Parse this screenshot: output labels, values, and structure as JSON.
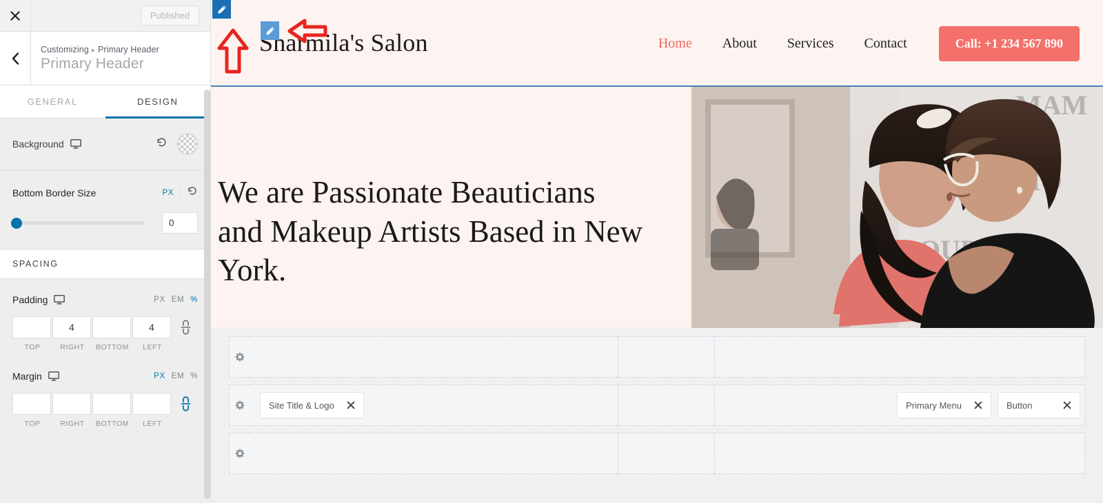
{
  "customizer": {
    "close_icon": "close-icon",
    "publish_label": "Published",
    "back_icon": "chevron-left-icon",
    "breadcrumb_root": "Customizing",
    "breadcrumb_sep": "▸",
    "breadcrumb_current": "Primary Header",
    "panel_title": "Primary Header",
    "tabs": [
      {
        "label": "GENERAL",
        "active": false
      },
      {
        "label": "DESIGN",
        "active": true
      }
    ],
    "background": {
      "label": "Background",
      "responsive_icon": "desktop-icon",
      "reset_icon": "reset-icon",
      "swatch_icon": "transparent-color-swatch"
    },
    "bottom_border": {
      "label": "Bottom Border Size",
      "unit": "PX",
      "reset_icon": "reset-icon",
      "value": "0",
      "slider_percent": 0
    },
    "spacing_section_title": "SPACING",
    "padding": {
      "label": "Padding",
      "responsive_icon": "desktop-icon",
      "units": [
        {
          "label": "PX",
          "active": false
        },
        {
          "label": "EM",
          "active": false
        },
        {
          "label": "%",
          "active": true
        }
      ],
      "fields": [
        {
          "caption": "TOP",
          "value": ""
        },
        {
          "caption": "RIGHT",
          "value": "4"
        },
        {
          "caption": "BOTTOM",
          "value": ""
        },
        {
          "caption": "LEFT",
          "value": "4"
        }
      ],
      "link_icon": "link-unlinked-icon",
      "link_active": false
    },
    "margin": {
      "label": "Margin",
      "responsive_icon": "desktop-icon",
      "units": [
        {
          "label": "PX",
          "active": true
        },
        {
          "label": "EM",
          "active": false
        },
        {
          "label": "%",
          "active": false
        }
      ],
      "fields": [
        {
          "caption": "TOP",
          "value": ""
        },
        {
          "caption": "RIGHT",
          "value": ""
        },
        {
          "caption": "BOTTOM",
          "value": ""
        },
        {
          "caption": "LEFT",
          "value": ""
        }
      ],
      "link_icon": "link-linked-icon",
      "link_active": true
    },
    "scrollbar": "sidebar-scrollbar"
  },
  "preview": {
    "site_title": "Sharmila's Salon",
    "nav": [
      {
        "label": "Home",
        "active": true
      },
      {
        "label": "About",
        "active": false
      },
      {
        "label": "Services",
        "active": false
      },
      {
        "label": "Contact",
        "active": false
      }
    ],
    "cta_label": "Call: +1 234 567 890",
    "hero_heading": "We are Passionate Beauticians and Makeup Artists Based in New York.",
    "hero_image_alt": "two-women-in-salon-photo",
    "edit_icons": [
      {
        "name": "edit-pencil-header-icon"
      },
      {
        "name": "edit-pencil-site-title-icon"
      }
    ],
    "annotations": [
      {
        "name": "red-arrow-up",
        "direction": "up"
      },
      {
        "name": "red-arrow-left",
        "direction": "left"
      }
    ]
  },
  "builder": {
    "rows": [
      {
        "name": "above-header-row",
        "gear_icon": "gear-icon",
        "left_items": [],
        "right_items": []
      },
      {
        "name": "primary-header-row",
        "gear_icon": "gear-icon",
        "left_items": [
          {
            "label": "Site Title & Logo",
            "remove_icon": "close-icon"
          }
        ],
        "right_items": [
          {
            "label": "Primary Menu",
            "remove_icon": "close-icon"
          },
          {
            "label": "Button",
            "remove_icon": "close-icon"
          }
        ]
      },
      {
        "name": "below-header-row",
        "gear_icon": "gear-icon",
        "left_items": [],
        "right_items": []
      }
    ]
  },
  "colors": {
    "accent_blue": "#0073aa",
    "brand_salmon": "#f4706a",
    "site_bg": "#fdf3f0",
    "annotation_red": "#e8241f",
    "pencil_dark": "#1b6fb5",
    "pencil_light": "#5c9bd6"
  }
}
